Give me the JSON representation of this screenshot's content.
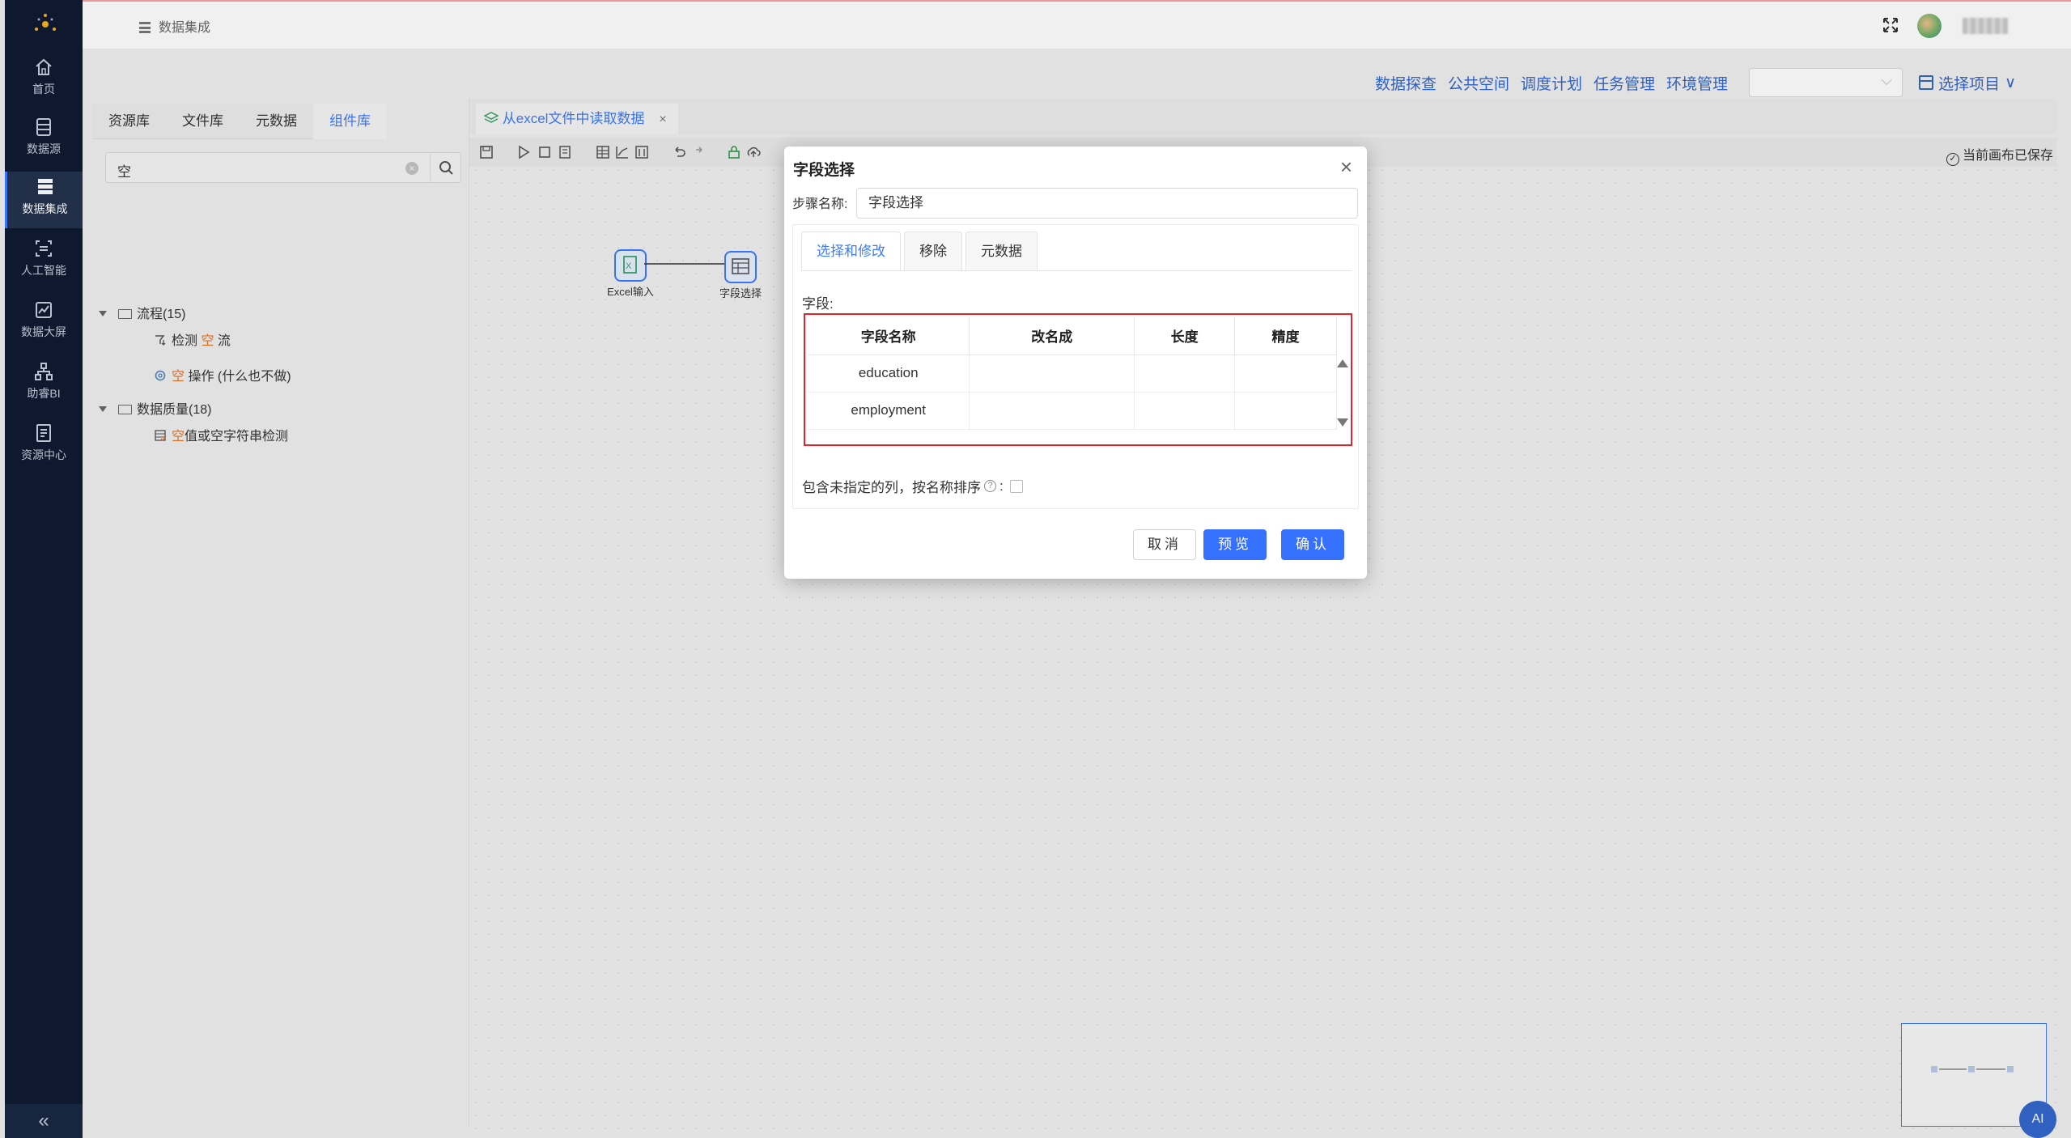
{
  "nav": {
    "items": [
      {
        "label": "首页",
        "icon": "home-icon"
      },
      {
        "label": "数据源",
        "icon": "database-icon"
      },
      {
        "label": "数据集成",
        "icon": "integration-icon"
      },
      {
        "label": "人工智能",
        "icon": "ai-icon"
      },
      {
        "label": "数据大屏",
        "icon": "chart-icon"
      },
      {
        "label": "助睿BI",
        "icon": "bi-icon"
      },
      {
        "label": "资源中心",
        "icon": "resource-icon"
      }
    ],
    "active": "数据集成",
    "collapse": "«"
  },
  "topbar": {
    "breadcrumb": "数据集成"
  },
  "subnav": {
    "links": [
      "数据探查",
      "公共空间",
      "调度计划",
      "任务管理",
      "环境管理"
    ],
    "project_label": "选择项目",
    "project_arrow": "∨"
  },
  "leftpanel": {
    "tabs": [
      "资源库",
      "文件库",
      "元数据",
      "组件库"
    ],
    "active_tab": "组件库",
    "search_value": "空",
    "tree": {
      "group1": "流程(15)",
      "item1_a": "检测 ",
      "item1_hl": "空",
      "item1_b": " 流",
      "item2_hl": "空",
      "item2_b": " 操作 (什么也不做)",
      "group2": "数据质量(18)",
      "item3_hl": "空",
      "item3_b": "值或空字符串检测"
    }
  },
  "canvas": {
    "tab_title": "从excel文件中读取数据",
    "tab_close": "×",
    "saved_text": "当前画布已保存",
    "node1": "Excel输入",
    "node2": "字段选择",
    "ai_label": "AI"
  },
  "modal": {
    "title": "字段选择",
    "close": "×",
    "step_label": "步骤名称:",
    "step_value": "字段选择",
    "tabs": [
      "选择和修改",
      "移除",
      "元数据"
    ],
    "active_tab": "选择和修改",
    "fields_label": "字段:",
    "columns": [
      "字段名称",
      "改名成",
      "长度",
      "精度"
    ],
    "rows": [
      [
        "education",
        "",
        "",
        ""
      ],
      [
        "employment",
        "",
        "",
        ""
      ]
    ],
    "include_label": "包含未指定的列，按名称排序",
    "include_suffix": ":",
    "help": "?",
    "cancel": "取消",
    "preview": "预览",
    "confirm": "确认"
  },
  "colors": {
    "accent": "#3670ff",
    "nav_bg": "#0f1b33",
    "highlight": "#e8742b",
    "error_border": "#e3242b"
  }
}
